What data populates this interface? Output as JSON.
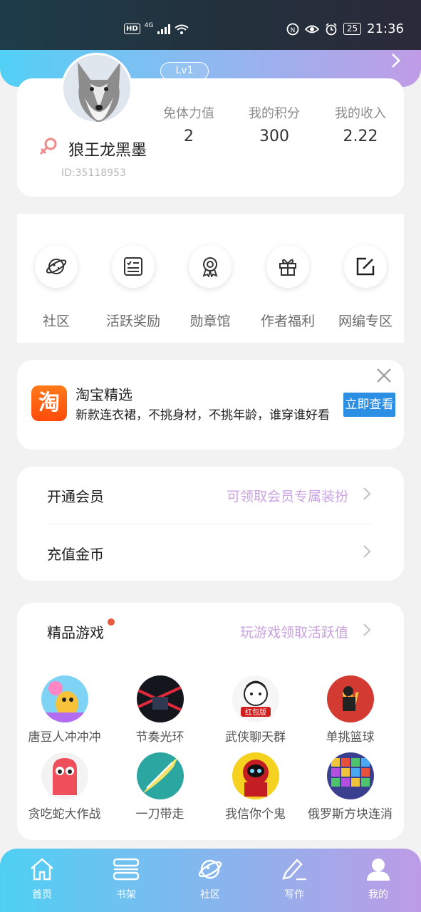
{
  "status_bar": {
    "hd": "HD",
    "network": "4G",
    "battery": "25",
    "time": "21:36"
  },
  "profile": {
    "level": "Lv1",
    "username": "狼王龙黑墨",
    "user_id": "ID:35118953",
    "stats": [
      {
        "label": "免体力值",
        "value": "2"
      },
      {
        "label": "我的积分",
        "value": "300"
      },
      {
        "label": "我的收入",
        "value": "2.22"
      }
    ]
  },
  "quick_menu": [
    {
      "label": "社区",
      "icon": "planet-icon"
    },
    {
      "label": "活跃奖励",
      "icon": "checklist-icon"
    },
    {
      "label": "勋章馆",
      "icon": "medal-icon"
    },
    {
      "label": "作者福利",
      "icon": "gift-icon"
    },
    {
      "label": "网编专区",
      "icon": "edit-icon"
    }
  ],
  "ad": {
    "logo": "淘",
    "title": "淘宝精选",
    "desc": "新款连衣裙，不挑身材，不挑年龄，谁穿谁好看",
    "button": "立即查看"
  },
  "member": {
    "vip_label": "开通会员",
    "vip_hint": "可领取会员专属装扮",
    "recharge_label": "充值金币"
  },
  "games": {
    "title": "精品游戏",
    "hint": "玩游戏领取活跃值",
    "items": [
      {
        "label": "唐豆人冲冲冲",
        "color": "#f6c33a"
      },
      {
        "label": "节奏光环",
        "color": "#c7252f"
      },
      {
        "label": "武侠聊天群",
        "color": "#ffffff"
      },
      {
        "label": "单挑篮球",
        "color": "#d33a32"
      },
      {
        "label": "贪吃蛇大作战",
        "color": "#ee4f5a"
      },
      {
        "label": "一刀带走",
        "color": "#2ba6a0"
      },
      {
        "label": "我信你个鬼",
        "color": "#f4d21f"
      },
      {
        "label": "俄罗斯方块连消",
        "color": "#3a3f8f"
      }
    ],
    "badge_text": "红包版"
  },
  "tabbar": [
    {
      "label": "首页",
      "icon": "home-icon"
    },
    {
      "label": "书架",
      "icon": "bookshelf-icon"
    },
    {
      "label": "社区",
      "icon": "planet-icon"
    },
    {
      "label": "写作",
      "icon": "pen-icon"
    },
    {
      "label": "我的",
      "icon": "user-icon"
    }
  ]
}
